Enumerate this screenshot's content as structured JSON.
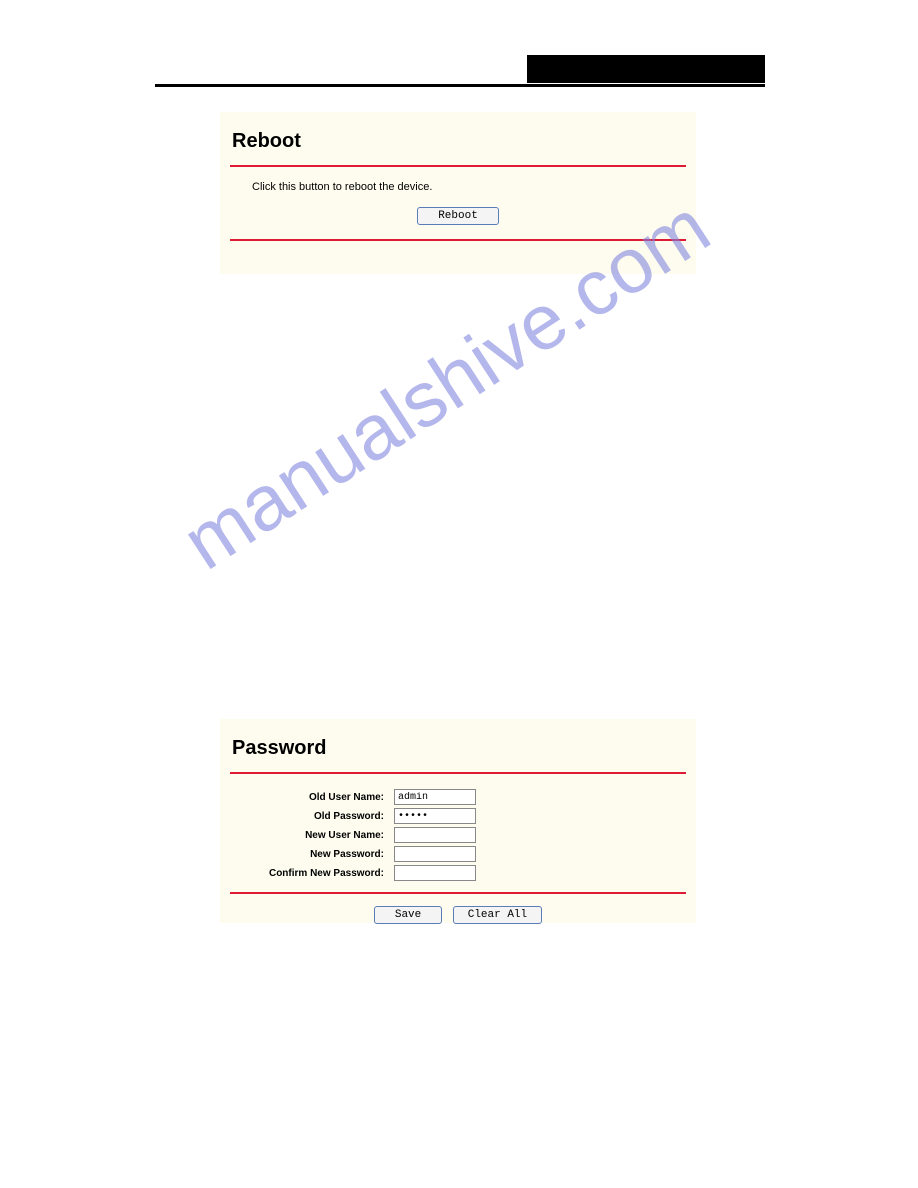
{
  "watermark_text": "manualshive.com",
  "reboot": {
    "title": "Reboot",
    "instruction": "Click this button to reboot the device.",
    "button_label": "Reboot"
  },
  "password": {
    "title": "Password",
    "old_username_label": "Old User Name:",
    "old_username_value": "admin",
    "old_password_label": "Old Password:",
    "old_password_value": "•••••",
    "new_username_label": "New User Name:",
    "new_username_value": "",
    "new_password_label": "New Password:",
    "new_password_value": "",
    "confirm_password_label": "Confirm New Password:",
    "confirm_password_value": "",
    "save_label": "Save",
    "clear_label": "Clear All"
  }
}
